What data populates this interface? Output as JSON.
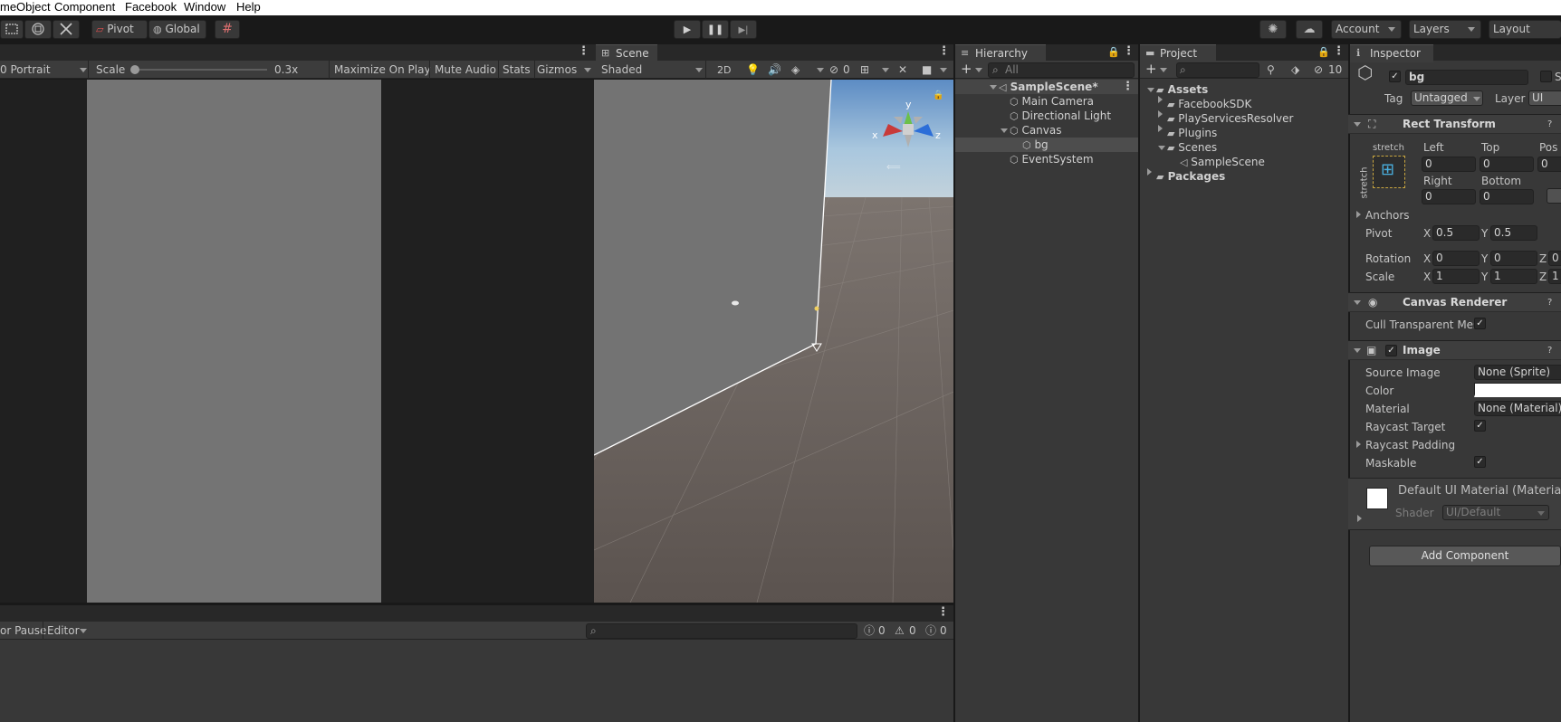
{
  "menu": [
    "meObject",
    "Component",
    "Facebook",
    "Window",
    "Help"
  ],
  "toolbar": {
    "pivot": "Pivot",
    "global": "Global",
    "account": "Account",
    "layers": "Layers",
    "layout": "Layout"
  },
  "game": {
    "resolution": "0 Portrait",
    "scale_label": "Scale",
    "scale_value": "0.3x",
    "maximize": "Maximize On Play",
    "mute": "Mute Audio",
    "stats": "Stats",
    "gizmos": "Gizmos"
  },
  "scene": {
    "tab": "Scene",
    "shading": "Shaded",
    "mode2d": "2D",
    "hidden_count": "0",
    "axis_x": "x",
    "axis_y": "y",
    "axis_z": "z"
  },
  "hierarchy": {
    "tab": "Hierarchy",
    "search_placeholder": "All",
    "scene_name": "SampleScene*",
    "items": [
      "Main Camera",
      "Directional Light",
      "Canvas",
      "bg",
      "EventSystem"
    ]
  },
  "project": {
    "tab": "Project",
    "hidden_count": "10",
    "assets": "Assets",
    "folders": [
      "FacebookSDK",
      "PlayServicesResolver",
      "Plugins",
      "Scenes"
    ],
    "scene_file": "SampleScene",
    "packages": "Packages"
  },
  "inspector": {
    "tab": "Inspector",
    "object_name": "bg",
    "static_label": "St",
    "tag_label": "Tag",
    "tag_value": "Untagged",
    "layer_label": "Layer",
    "layer_value": "UI",
    "rect_transform": "Rect Transform",
    "stretch_h": "stretch",
    "stretch_v": "stretch",
    "left_label": "Left",
    "top_label": "Top",
    "pos_label": "Pos",
    "left": "0",
    "top": "0",
    "posz": "0",
    "right_label": "Right",
    "bottom_label": "Bottom",
    "right": "0",
    "bottom": "0",
    "anchors": "Anchors",
    "pivot_label": "Pivot",
    "pivot_x": "0.5",
    "pivot_y": "0.5",
    "rotation_label": "Rotation",
    "rot_x": "0",
    "rot_y": "0",
    "rot_z": "0",
    "scale_label": "Scale",
    "scale_x": "1",
    "scale_y": "1",
    "scale_z": "1",
    "x": "X",
    "y": "Y",
    "z": "Z",
    "canvas_renderer": "Canvas Renderer",
    "cull": "Cull Transparent Mes",
    "image": "Image",
    "source_image_label": "Source Image",
    "source_image": "None (Sprite)",
    "color_label": "Color",
    "material_label": "Material",
    "material": "None (Material)",
    "raycast_target": "Raycast Target",
    "raycast_padding": "Raycast Padding",
    "maskable": "Maskable",
    "mat_name": "Default UI Material (Material)",
    "shader_label": "Shader",
    "shader": "UI/Default",
    "add_component": "Add Component"
  },
  "console": {
    "pause": "or Pause",
    "editor": "Editor",
    "logs": "0",
    "warnings": "0",
    "errors": "0"
  }
}
